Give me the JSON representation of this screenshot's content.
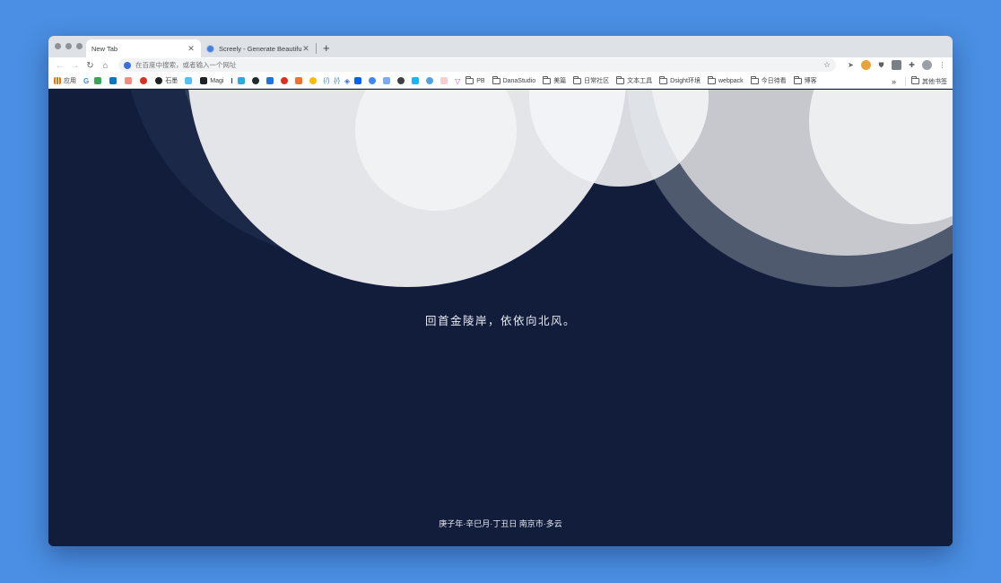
{
  "tabs": [
    {
      "title": "New Tab",
      "active": true
    },
    {
      "title": "Screely - Generate Beautiful Mockups",
      "active": false
    }
  ],
  "toolbar": {
    "search_placeholder": "在百度中搜索，或者输入一个网址"
  },
  "bookmarks": {
    "apps_label": "应用",
    "items": [
      {
        "label": "石墨",
        "icon": "shimo-icon"
      },
      {
        "label": "Magi",
        "icon": "magi-icon"
      },
      {
        "label": "PB",
        "icon": "folder-icon"
      },
      {
        "label": "DanaStudio",
        "icon": "folder-icon"
      },
      {
        "label": "美篇",
        "icon": "folder-icon"
      },
      {
        "label": "日常社区",
        "icon": "folder-icon"
      },
      {
        "label": "文本工具",
        "icon": "folder-icon"
      },
      {
        "label": "Dsight环境",
        "icon": "folder-icon"
      },
      {
        "label": "webpack",
        "icon": "folder-icon"
      },
      {
        "label": "今日待看",
        "icon": "folder-icon"
      },
      {
        "label": "博客",
        "icon": "folder-icon"
      }
    ],
    "overflow_label": "»",
    "other_label": "其他书签"
  },
  "page": {
    "poem": "回首金陵岸，依依向北风。",
    "dateline": "庚子年·辛巳月·丁丑日  南京市·多云"
  },
  "colors": {
    "background": "#111d3b",
    "desktop": "#4a8fe3"
  }
}
